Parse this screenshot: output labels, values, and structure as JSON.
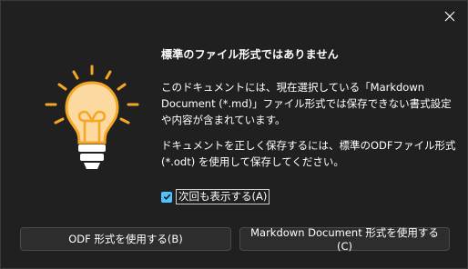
{
  "dialog": {
    "title": "標準のファイル形式ではありません",
    "message1": "このドキュメントには、現在選択している「Markdown Document (*.md)」ファイル形式では保存できない書式設定や内容が含まれています。",
    "message2": "ドキュメントを正しく保存するには、標準のODFファイル形式 (*.odt) を使用して保存してください。",
    "checkbox_label": "次回も表示する(A)",
    "checkbox_checked": true,
    "buttons": {
      "odf_label": "ODF 形式を使用する(B)",
      "markdown_label": "Markdown Document 形式を使用する(C)"
    },
    "icon": "lightbulb-icon",
    "colors": {
      "background": "#202020",
      "accent_orange": "#f5a623",
      "bulb_fill": "#fcd9a0",
      "checkbox_accent": "#4cc2ff"
    }
  }
}
